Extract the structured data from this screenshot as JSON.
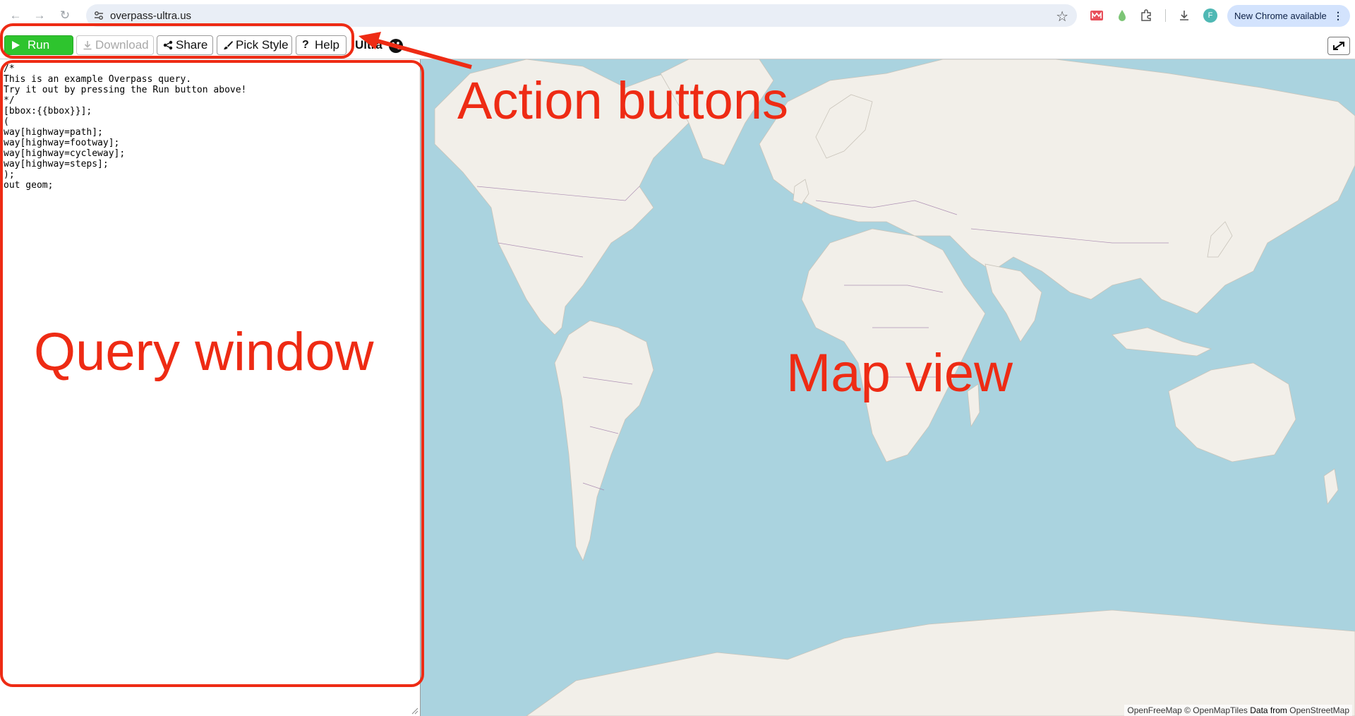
{
  "browser": {
    "url": "overpass-ultra.us",
    "profile_initial": "F",
    "update_label": "New Chrome available",
    "menu_glyph": "⋮"
  },
  "toolbar": {
    "run_label": "Run",
    "download_label": "Download",
    "share_label": "Share",
    "pick_style_label": "Pick Style",
    "help_label": "Help",
    "brand_label": "Ultra"
  },
  "editor": {
    "query_text": "/*\nThis is an example Overpass query.\nTry it out by pressing the Run button above!\n*/\n[bbox:{{bbox}}];\n(\nway[highway=path];\nway[highway=footway];\nway[highway=cycleway];\nway[highway=steps];\n);\nout geom;"
  },
  "map": {
    "attribution_part1": "OpenFreeMap © OpenMapTiles",
    "attribution_part2": "Data from",
    "attribution_part3": "OpenStreetMap"
  },
  "annotations": {
    "action_buttons": "Action buttons",
    "query_window": "Query window",
    "map_view": "Map view"
  },
  "colors": {
    "annotation_red": "#ee2b14",
    "run_green": "#2ec42e",
    "ocean": "#aad3df",
    "land": "#f2efe9",
    "border": "#9e7aa8"
  },
  "icons": {
    "back": "back-arrow-icon",
    "forward": "forward-arrow-icon",
    "reload": "reload-icon",
    "bookmark": "star-icon",
    "run": "play-icon",
    "download": "download-icon",
    "share": "share-icon",
    "pick_style": "brush-icon",
    "help": "question-icon",
    "fullscreen": "expand-icon"
  }
}
